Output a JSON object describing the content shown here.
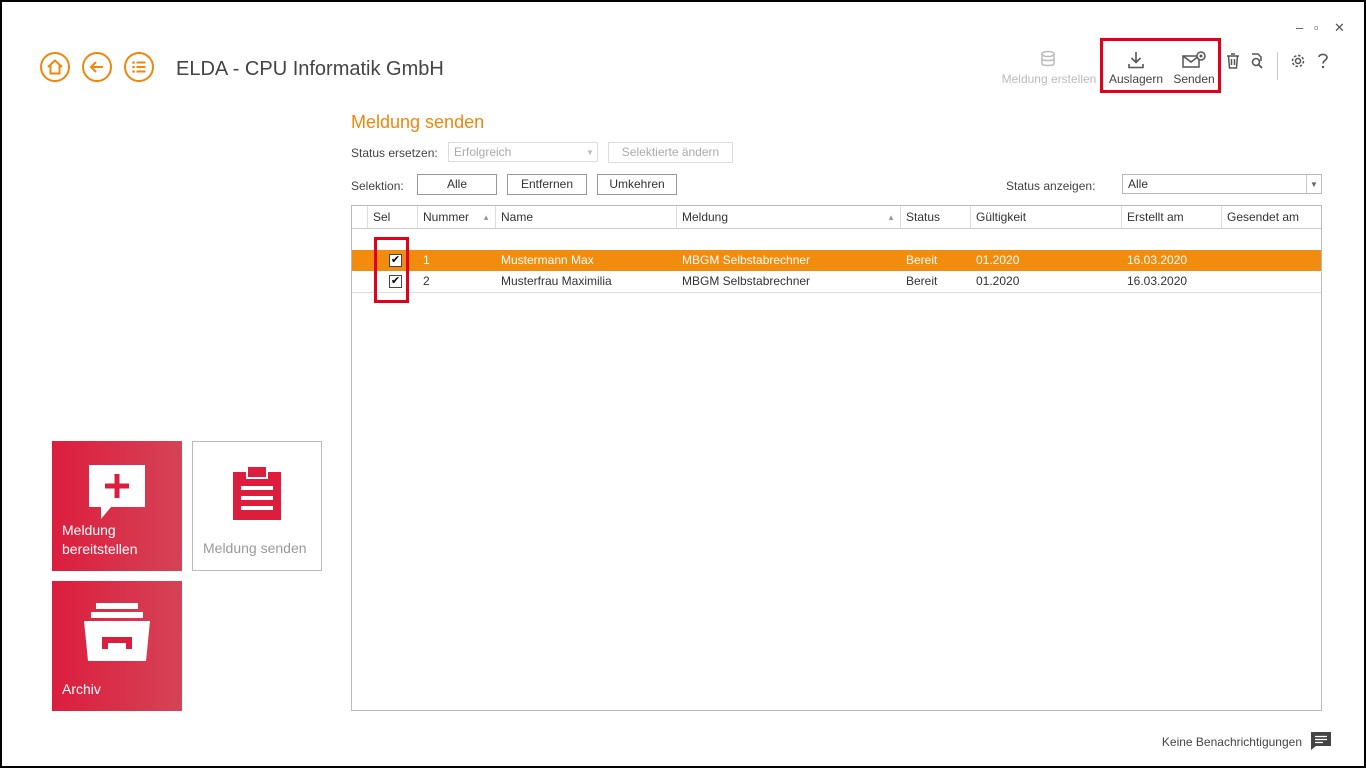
{
  "app": {
    "title": "ELDA - CPU Informatik GmbH"
  },
  "window_controls": {
    "minimize": "–",
    "maximize": "▫",
    "close": "✕"
  },
  "toolbar": {
    "meldung_erstellen": "Meldung erstellen",
    "auslagern": "Auslagern",
    "senden": "Senden"
  },
  "section": {
    "title": "Meldung senden"
  },
  "status_replace": {
    "label": "Status ersetzen:",
    "value": "Erfolgreich",
    "button": "Selektierte ändern"
  },
  "selection": {
    "label": "Selektion:",
    "all": "Alle",
    "remove": "Entfernen",
    "invert": "Umkehren"
  },
  "status_filter": {
    "label": "Status anzeigen:",
    "value": "Alle"
  },
  "table": {
    "columns": [
      "Sel",
      "Nummer",
      "Name",
      "Meldung",
      "Status",
      "Gültigkeit",
      "Erstellt am",
      "Gesendet am"
    ],
    "rows": [
      {
        "checked": "✔",
        "nummer": "1",
        "name": "Mustermann Max",
        "meldung": "MBGM Selbstabrechner",
        "status": "Bereit",
        "gueltigkeit": "01.2020",
        "erstellt": "16.03.2020",
        "gesendet": ""
      },
      {
        "checked": "✔",
        "nummer": "2",
        "name": "Musterfrau Maximilia",
        "meldung": "MBGM Selbstabrechner",
        "status": "Bereit",
        "gueltigkeit": "01.2020",
        "erstellt": "16.03.2020",
        "gesendet": ""
      }
    ]
  },
  "tiles": {
    "bereitstellen_line1": "Meldung",
    "bereitstellen_line2": "bereitstellen",
    "senden": "Meldung senden",
    "archiv": "Archiv"
  },
  "footer": {
    "notifications": "Keine Benachrichtigungen"
  },
  "colors": {
    "accent": "#f0860a",
    "row_selected": "#f28c0f",
    "tile_red": "#dc1d3e",
    "highlight": "#e3001b"
  }
}
